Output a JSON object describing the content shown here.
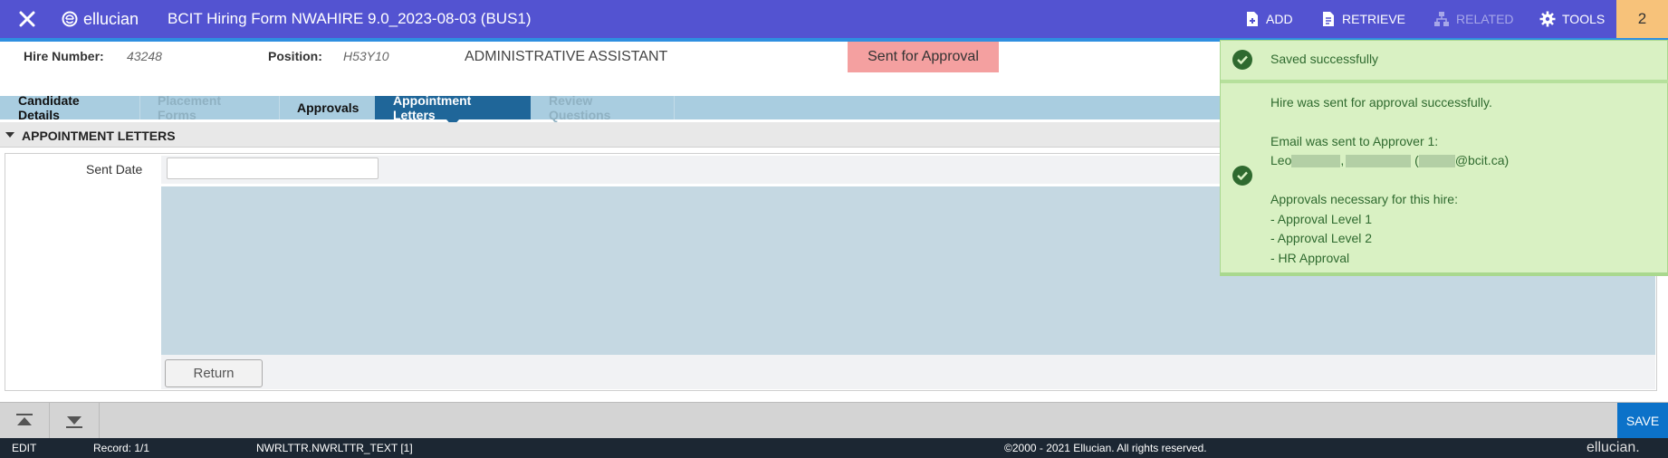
{
  "app": {
    "logo_text": "ellucian",
    "title": "BCIT Hiring Form NWAHIRE 9.0_2023-08-03 (BUS1)",
    "tools": {
      "add": "ADD",
      "retrieve": "RETRIEVE",
      "related": "RELATED",
      "tools": "TOOLS"
    },
    "notification_count": "2",
    "accent_color": "#5353d1"
  },
  "header": {
    "hire_number_label": "Hire Number:",
    "hire_number_value": "43248",
    "position_label": "Position:",
    "position_value": "H53Y10",
    "position_title": "ADMINISTRATIVE ASSISTANT",
    "status": "Sent for Approval"
  },
  "tabs": [
    {
      "label": "Candidate Details",
      "state": "normal"
    },
    {
      "label": "Placement Forms",
      "state": "disabled"
    },
    {
      "label": "Approvals",
      "state": "normal"
    },
    {
      "label": "Appointment Letters",
      "state": "active"
    },
    {
      "label": "Review Questions",
      "state": "disabled"
    }
  ],
  "section": {
    "title": "APPOINTMENT LETTERS",
    "sent_date_label": "Sent Date",
    "sent_date_value": "",
    "return_label": "Return"
  },
  "toast": {
    "message1": "Saved successfully",
    "line1": "Hire was sent for approval successfully.",
    "line2": "Email was sent to Approver 1:",
    "line3_name_visible": "Leo",
    "line3_email_visible": "@bcit.ca)",
    "line4": "Approvals necessary for this hire:",
    "approvals": [
      "- Approval Level 1",
      "- Approval Level 2",
      "- HR Approval"
    ],
    "color": "#2f6a2f"
  },
  "footer": {
    "save_label": "SAVE",
    "mode": "EDIT",
    "record": "Record: 1/1",
    "field": "NWRLTTR.NWRLTTR_TEXT [1]",
    "copyright": "©2000 - 2021 Ellucian. All rights reserved.",
    "logo": "ellucian."
  }
}
